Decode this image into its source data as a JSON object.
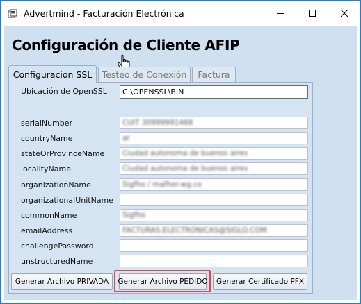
{
  "window": {
    "title": "Advertmind - Facturación Electrónica",
    "app_icon": "app-icon",
    "controls": [
      "minimize-icon",
      "maximize-icon",
      "close-icon"
    ]
  },
  "heading": "Configuración de Cliente AFIP",
  "tabs": [
    {
      "label": "Configuracion SSL",
      "active": true
    },
    {
      "label": "Testeo de Conexión",
      "active": false
    },
    {
      "label": "Factura",
      "active": false
    }
  ],
  "openssl": {
    "label": "Ubicación de OpenSSL",
    "value": "C:\\OPENSSL\\BIN"
  },
  "fields": [
    {
      "label": "serialNumber",
      "value": "CUIT 30999991468"
    },
    {
      "label": "countryName",
      "value": "ar"
    },
    {
      "label": "stateOrProvinceName",
      "value": "Ciudad autonoma de buenos aires"
    },
    {
      "label": "localityName",
      "value": "Ciudad autonoma de buenos aires"
    },
    {
      "label": "organizationName",
      "value": "Sigfho / mafher.wg.co"
    },
    {
      "label": "organizationalUnitName",
      "value": ""
    },
    {
      "label": "commonName",
      "value": "Sigfho"
    },
    {
      "label": "emailAddress",
      "value": "FACTURAS.ELECTRONICAS@SIGLO.COM"
    },
    {
      "label": "challengePassword",
      "value": ""
    },
    {
      "label": "unstructuredName",
      "value": ""
    }
  ],
  "buttons": {
    "privada": "Generar Archivo PRIVADA",
    "pedido": "Generar Archivo PEDIDO",
    "pfx": "Generar Certificado PFX"
  },
  "colors": {
    "window_border": "#1a7fd6",
    "client_bg": "#cfe0f0",
    "highlight": "#e04848"
  }
}
